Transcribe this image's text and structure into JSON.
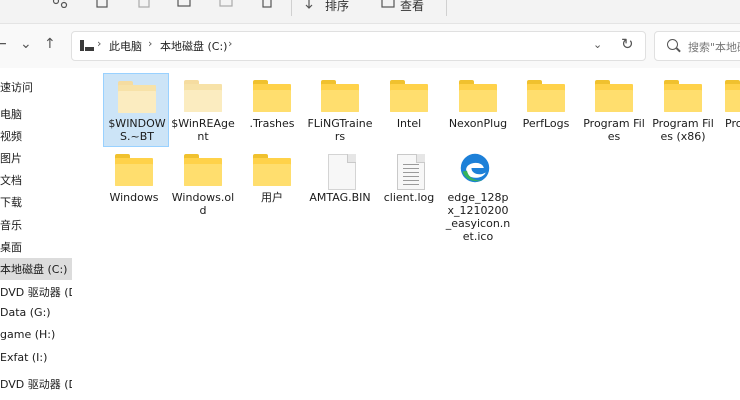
{
  "toolbar": {
    "sort_label": "排序",
    "view_label": "查看",
    "more_label": "···"
  },
  "nav": {
    "back": "←",
    "forward": "→",
    "recent": "⌄",
    "up": "↑",
    "breadcrumb": [
      "此电脑",
      "本地磁盘 (C:)"
    ],
    "breadcrumb_sep": "›",
    "dropdown": "⌄",
    "refresh": "↻",
    "search_placeholder": "搜索\"本地磁"
  },
  "sidebar": {
    "items": [
      {
        "label": "速访问"
      },
      {
        "label": "电脑"
      },
      {
        "label": "视频"
      },
      {
        "label": "图片"
      },
      {
        "label": "文档"
      },
      {
        "label": "下载"
      },
      {
        "label": "音乐"
      },
      {
        "label": "桌面"
      },
      {
        "label": "本地磁盘 (C:)",
        "selected": true
      },
      {
        "label": "DVD 驱动器 (D:)"
      },
      {
        "label": "Data (G:)"
      },
      {
        "label": "game (H:)"
      },
      {
        "label": "Exfat (I:)"
      },
      {
        "label": "DVD 驱动器 (D:) C"
      }
    ]
  },
  "files": {
    "row1": [
      {
        "name": "$WINDOWS.~BT",
        "type": "folder",
        "icon": "folder-icon",
        "hidden": true,
        "selected": true
      },
      {
        "name": "$WinREAgent",
        "type": "folder",
        "icon": "folder-icon",
        "hidden": true
      },
      {
        "name": ".Trashes",
        "type": "folder",
        "icon": "folder-icon"
      },
      {
        "name": "FLiNGTrainers",
        "type": "folder",
        "icon": "folder-icon"
      },
      {
        "name": "Intel",
        "type": "folder",
        "icon": "folder-icon"
      },
      {
        "name": "NexonPlug",
        "type": "folder",
        "icon": "folder-icon"
      },
      {
        "name": "PerfLogs",
        "type": "folder",
        "icon": "folder-icon"
      },
      {
        "name": "Program Files",
        "type": "folder",
        "icon": "folder-icon"
      },
      {
        "name": "Program Files (x86)",
        "type": "folder",
        "icon": "folder-icon"
      },
      {
        "name": "Pro",
        "type": "folder",
        "icon": "folder-icon"
      }
    ],
    "row2": [
      {
        "name": "Windows",
        "type": "folder",
        "icon": "folder-icon"
      },
      {
        "name": "Windows.old",
        "type": "folder",
        "icon": "folder-icon"
      },
      {
        "name": "用户",
        "type": "folder",
        "icon": "folder-icon"
      },
      {
        "name": "AMTAG.BIN",
        "type": "file",
        "icon": "blank-file-icon"
      },
      {
        "name": "client.log",
        "type": "file",
        "icon": "text-file-icon"
      },
      {
        "name": "edge_128px_1210200_easyicon.net.ico",
        "type": "file",
        "icon": "edge-icon"
      }
    ]
  },
  "colors": {
    "selection": "#cce4f7",
    "folder": "#ffd24a",
    "edge_blue": "#1d80d8",
    "edge_green": "#36b35b"
  }
}
